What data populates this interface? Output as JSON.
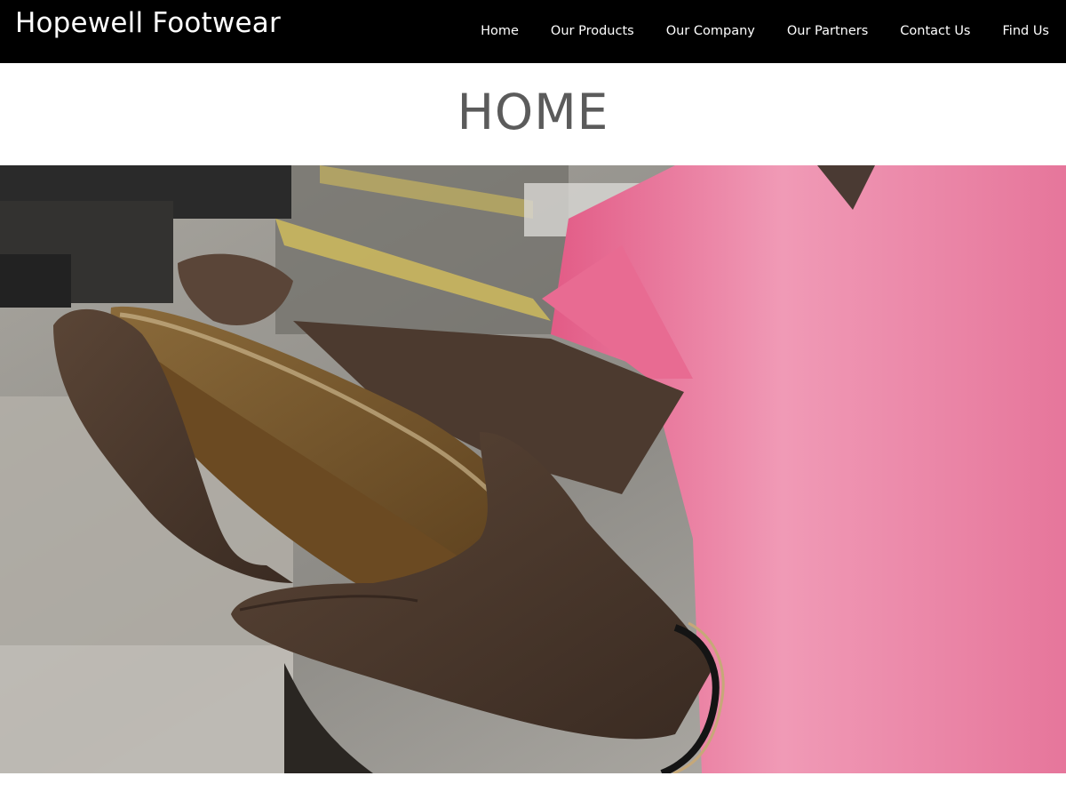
{
  "header": {
    "brand": "Hopewell Footwear",
    "nav": [
      {
        "label": "Home"
      },
      {
        "label": "Our Products"
      },
      {
        "label": "Our Company"
      },
      {
        "label": "Our Partners"
      },
      {
        "label": "Contact Us"
      },
      {
        "label": "Find Us"
      }
    ]
  },
  "main": {
    "title": "HOME"
  },
  "colors": {
    "header_bg": "#000000",
    "title_text": "#5b5b5b",
    "shirt": "#ec7f9f"
  }
}
